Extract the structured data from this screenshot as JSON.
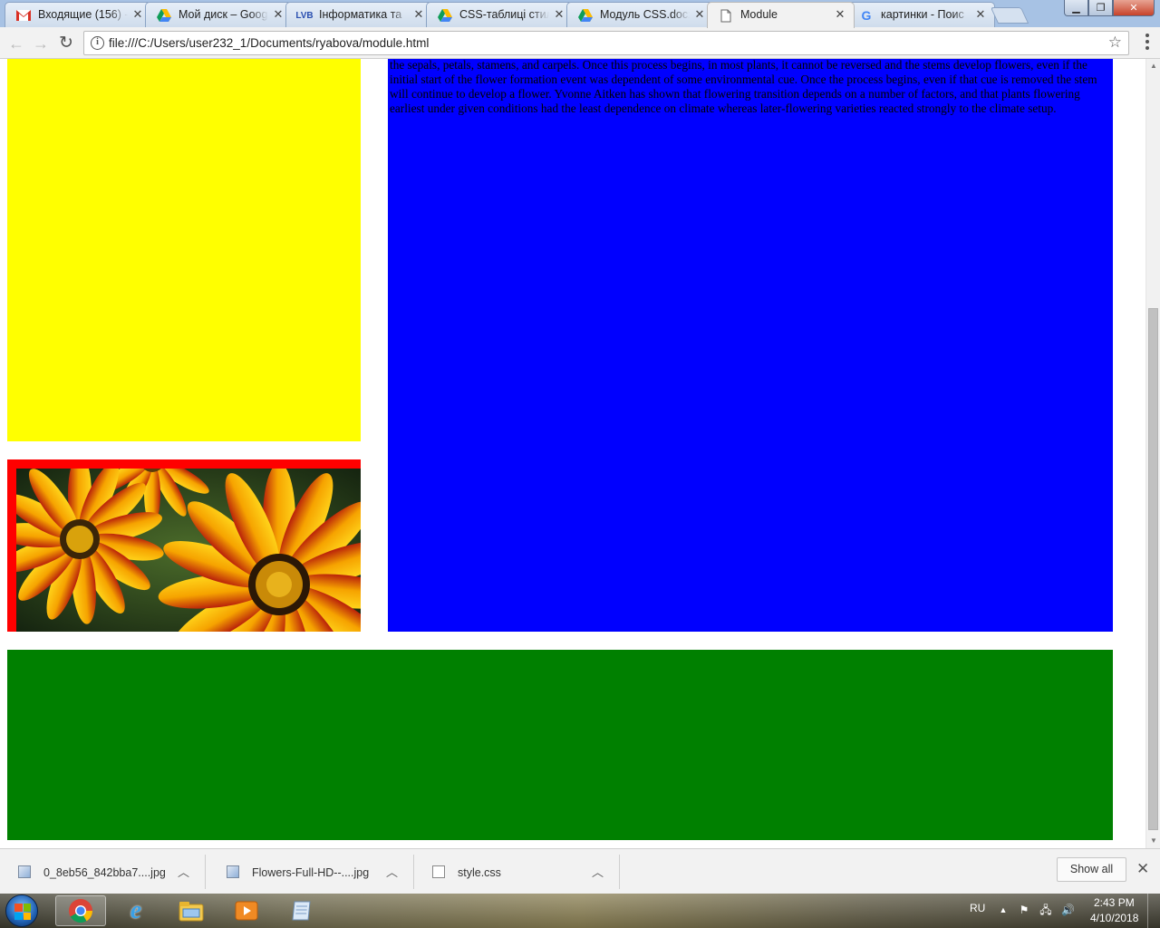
{
  "browser": {
    "tabs": [
      {
        "favicon": "gmail-icon",
        "title": "Входящие (156) -",
        "active": false
      },
      {
        "favicon": "google-drive-icon",
        "title": "Мой диск – Goog",
        "active": false
      },
      {
        "favicon": "lvb-icon",
        "title": "Інформатика та",
        "active": false
      },
      {
        "favicon": "google-drive-icon",
        "title": "CSS-таблиці стил",
        "active": false
      },
      {
        "favicon": "google-drive-icon",
        "title": "Модуль CSS.docx",
        "active": false
      },
      {
        "favicon": "page-icon",
        "title": "Module",
        "active": true
      },
      {
        "favicon": "google-icon",
        "title": "картинки - Поис",
        "active": false
      }
    ],
    "address_bar": {
      "url": "file:///C:/Users/user232_1/Documents/ryabova/module.html"
    }
  },
  "page": {
    "body_text": "differentiation of leaf, but the stem tissues into tissue that will grow into the reproductive organs. Growth of the central part of the stem tip stops or flattens out and the sides develop protuberances in a whorled or spiral fashion around the outside of the stem end. These protuberances develop into the sepals, petals, stamens, and carpels. Once this process begins, in most plants, it cannot be reversed and the stems develop flowers, even if the initial start of the flower formation event was dependent of some environmental cue. Once the process begins, even if that cue is removed the stem will continue to develop a flower. Yvonne Aitken has shown that flowering transition depends on a number of factors, and that plants flowering earliest under given conditions had the least dependence on climate whereas later-flowering varieties reacted strongly to the climate setup.",
    "colors": {
      "yellow_box": "#ffff00",
      "image_frame": "#ff0000",
      "blue_box": "#0000ff",
      "green_box": "#008000"
    }
  },
  "downloads": {
    "items": [
      {
        "name": "0_8eb56_842bba7....jpg",
        "icon": "image-file-icon"
      },
      {
        "name": "Flowers-Full-HD--....jpg",
        "icon": "image-file-icon"
      },
      {
        "name": "style.css",
        "icon": "css-file-icon"
      }
    ],
    "show_all_label": "Show all"
  },
  "taskbar": {
    "language": "RU",
    "time": "2:43 PM",
    "date": "4/10/2018",
    "apps": [
      "chrome-icon",
      "internet-explorer-icon",
      "file-explorer-icon",
      "media-player-icon",
      "notepad-icon"
    ]
  }
}
